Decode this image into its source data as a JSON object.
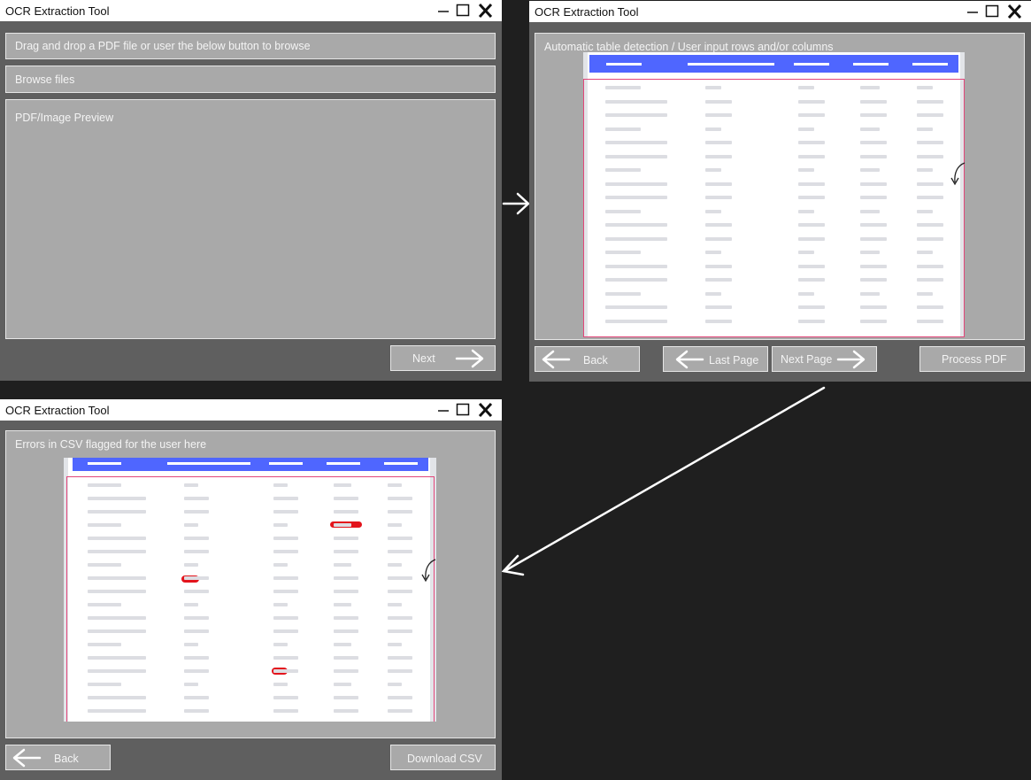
{
  "window_title": "OCR Extraction Tool",
  "screen1": {
    "dropzone_text": "Drag and drop a PDF file or user the below button to browse",
    "browse_label": "Browse files",
    "preview_label": "PDF/Image Preview",
    "next_label": "Next"
  },
  "screen2": {
    "panel_label": "Automatic table detection / User input rows and/or columns",
    "back_label": "Back",
    "last_page_label": "Last Page",
    "next_page_label": "Next Page",
    "process_label": "Process PDF"
  },
  "screen3": {
    "panel_label": "Errors in CSV flagged for the user here",
    "back_label": "Back",
    "download_label": "Download CSV"
  },
  "colors": {
    "background": "#1f1f1f",
    "window_body": "#5f5f5f",
    "panel": "#a9a9a9",
    "table_header": "#4f66ff",
    "table_frame": "#e2467a",
    "error_mark": "#e3141c"
  },
  "icons": [
    "minimize-icon",
    "maximize-icon",
    "close-icon",
    "arrow-right-icon",
    "arrow-left-icon"
  ]
}
